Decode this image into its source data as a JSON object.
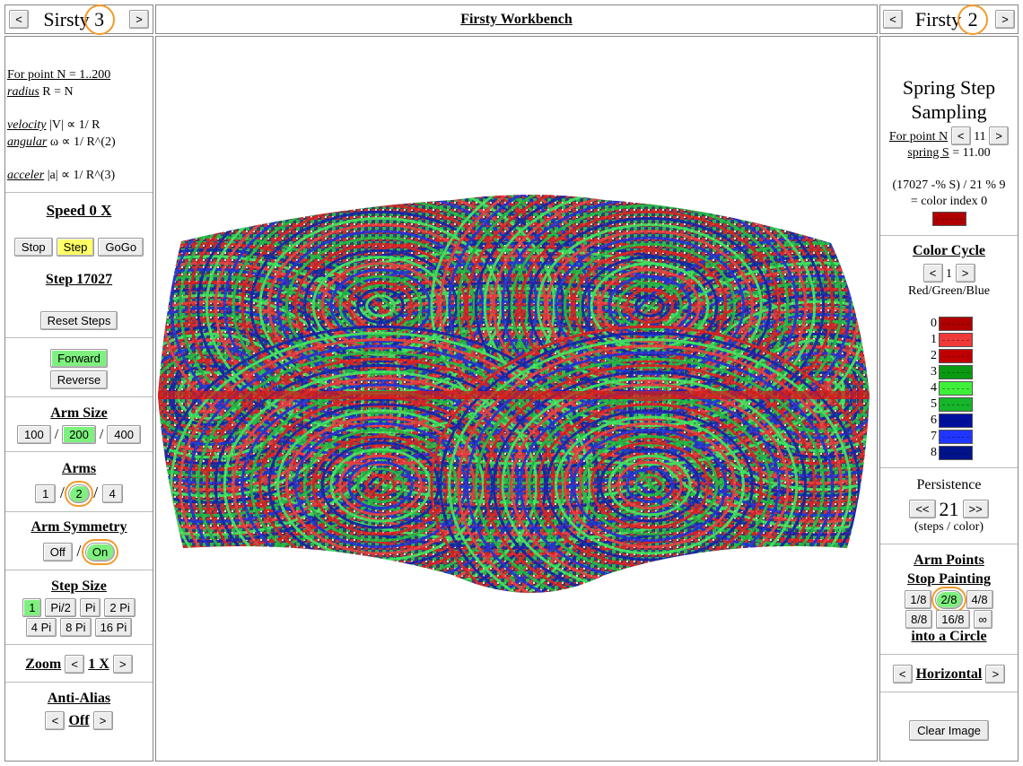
{
  "left_header": {
    "prev": "<",
    "title": "Sirsty",
    "number": "3",
    "next": ">"
  },
  "center_header": {
    "title": "Firsty Workbench"
  },
  "right_header": {
    "prev": "<",
    "title": "Firsty",
    "number": "2",
    "next": ">"
  },
  "left": {
    "formula": {
      "line1": "For point N = 1..200",
      "radius_link": "radius",
      "radius_rest": " R = N",
      "velocity_link": "velocity",
      "velocity_rest": " |V| ∝ 1/ R",
      "angular_link": "angular",
      "angular_rest": " ω ∝ 1/ R^(2)",
      "acceler_link": "acceler",
      "acceler_rest": " |a| ∝ 1/ R^(3)"
    },
    "speed": {
      "title": "Speed 0 X",
      "stop": "Stop",
      "step": "Step",
      "gogo": "GoGo",
      "step_count": "Step 17027",
      "reset": "Reset Steps"
    },
    "direction": {
      "forward": "Forward",
      "reverse": "Reverse"
    },
    "arm_size": {
      "title": "Arm Size",
      "opt1": "100",
      "sep": "/",
      "opt2": "200",
      "opt3": "400"
    },
    "arms": {
      "title": "Arms",
      "opt1": "1",
      "sep": "/",
      "opt2": "2",
      "opt3": "4"
    },
    "arm_symmetry": {
      "title": "Arm Symmetry",
      "off": "Off",
      "sep": "/",
      "on": "On"
    },
    "step_size": {
      "title": "Step Size",
      "opts": [
        "1",
        "Pi/2",
        "Pi",
        "2 Pi",
        "4 Pi",
        "8 Pi",
        "16 Pi"
      ]
    },
    "zoom": {
      "title": "Zoom",
      "prev": "<",
      "value": "1 X",
      "next": ">"
    },
    "anti_alias": {
      "title": "Anti-Alias",
      "prev": "<",
      "value": "Off",
      "next": ">"
    }
  },
  "right": {
    "spring": {
      "title1": "Spring Step",
      "title2": "Sampling",
      "point_label": "For point N",
      "prev": "<",
      "point_value": "11",
      "next": ">",
      "spring_link": "spring S",
      "spring_rest": " = 11.00",
      "formula": "(17027 -% S) / 21 % 9",
      "color_index": "= color index 0"
    },
    "color_cycle": {
      "title": "Color Cycle",
      "prev": "<",
      "value": "1",
      "next": ">",
      "subtitle": "Red/Green/Blue"
    },
    "palette": [
      {
        "index": "0",
        "color": "#b00000"
      },
      {
        "index": "1",
        "color": "#f03a3a"
      },
      {
        "index": "2",
        "color": "#c00000"
      },
      {
        "index": "3",
        "color": "#0a9a12"
      },
      {
        "index": "4",
        "color": "#3ff03a"
      },
      {
        "index": "5",
        "color": "#16b52a"
      },
      {
        "index": "6",
        "color": "#000f9e"
      },
      {
        "index": "7",
        "color": "#2036ff"
      },
      {
        "index": "8",
        "color": "#00138a"
      }
    ],
    "persistence": {
      "title": "Persistence",
      "prev": "<<",
      "value": "21",
      "next": ">>",
      "unit": "(steps / color)"
    },
    "arm_points": {
      "title1": "Arm Points",
      "title2": "Stop Painting",
      "opts": [
        "1/8",
        "2/8",
        "4/8",
        "8/8",
        "16/8",
        "∞"
      ],
      "footer": "into a Circle"
    },
    "orientation": {
      "prev": "<",
      "value": "Horizontal",
      "next": ">"
    },
    "clear": "Clear Image"
  },
  "colors": {
    "accent_ring": "#f39a2a",
    "on_green": "#7ef07e",
    "step_yellow": "#ffff66"
  }
}
